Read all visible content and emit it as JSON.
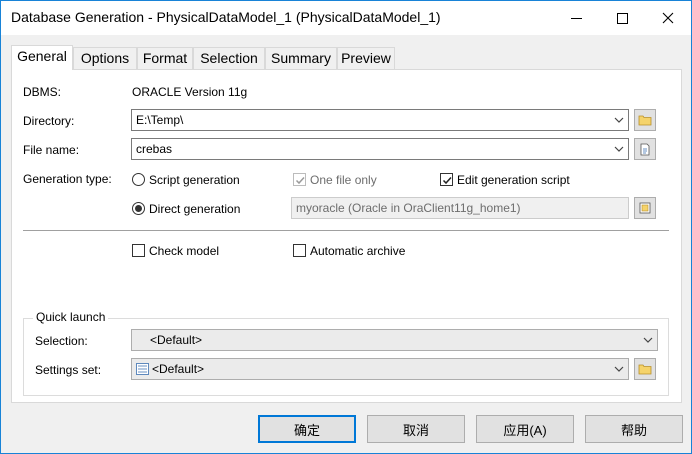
{
  "window": {
    "title": "Database Generation - PhysicalDataModel_1 (PhysicalDataModel_1)"
  },
  "tabs": [
    {
      "label": "General",
      "active": true
    },
    {
      "label": "Options",
      "active": false
    },
    {
      "label": "Format",
      "active": false
    },
    {
      "label": "Selection",
      "active": false
    },
    {
      "label": "Summary",
      "active": false
    },
    {
      "label": "Preview",
      "active": false
    }
  ],
  "general": {
    "dbms_label": "DBMS:",
    "dbms_value": "ORACLE Version 11g",
    "directory_label": "Directory:",
    "directory_value": "E:\\Temp\\",
    "filename_label": "File name:",
    "filename_value": "crebas",
    "gentype_label": "Generation type:",
    "script_generation": "Script generation",
    "direct_generation": "Direct generation",
    "one_file_only": "One file only",
    "edit_script": "Edit generation script",
    "datasource_value": "myoracle (Oracle in OraClient11g_home1)",
    "check_model": "Check model",
    "automatic_archive": "Automatic archive"
  },
  "state": {
    "generation_type": "Direct generation",
    "one_file_only_checked": true,
    "one_file_only_enabled": false,
    "edit_script_checked": true,
    "check_model_checked": false,
    "automatic_archive_checked": false
  },
  "quick_launch": {
    "title": "Quick launch",
    "selection_label": "Selection:",
    "selection_value": "<Default>",
    "settings_label": "Settings set:",
    "settings_value": "<Default>"
  },
  "buttons": {
    "ok": "确定",
    "cancel": "取消",
    "apply": "应用(A)",
    "help": "帮助"
  },
  "icons": {
    "folder": "folder-icon",
    "file": "file-icon",
    "datasource": "datasource-icon",
    "settings": "settings-set-icon"
  },
  "colors": {
    "accent": "#0078d7",
    "window_border": "#1883d7"
  }
}
